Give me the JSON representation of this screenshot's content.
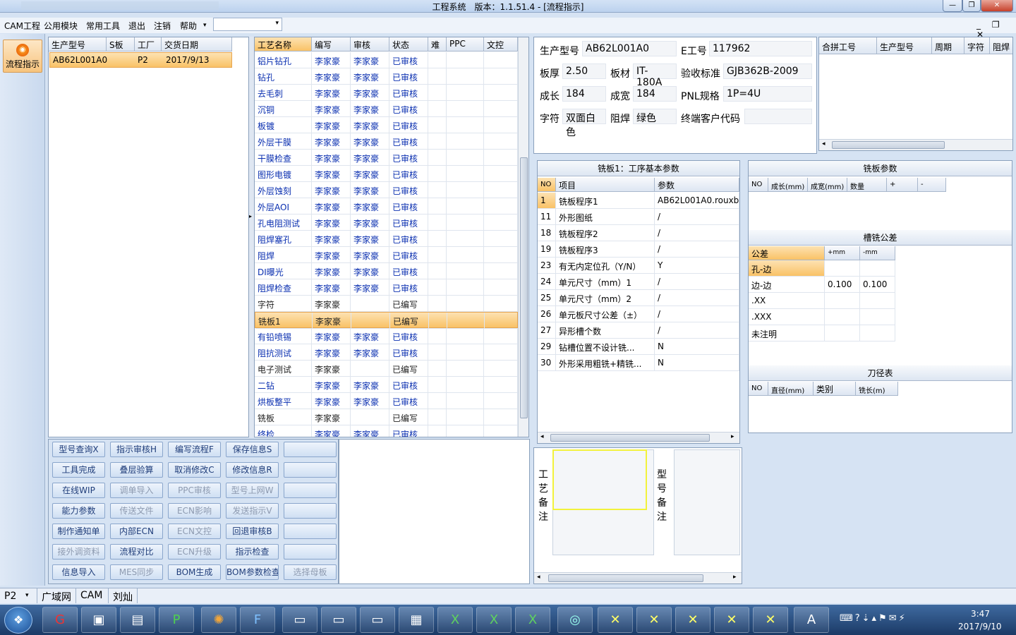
{
  "window": {
    "title": "工程系统　版本：1.1.51.4 - [流程指示]",
    "min": "—",
    "max": "❐",
    "close": "✕"
  },
  "menu": [
    {
      "label": "CAM工程"
    },
    {
      "label": "公用模块"
    },
    {
      "label": "常用工具"
    },
    {
      "label": "退出"
    },
    {
      "label": "注销"
    },
    {
      "label": "帮助"
    }
  ],
  "menu_arrow": "▾",
  "mdi_controls": "_ ❐ ✕",
  "nav": {
    "label": "流程指示"
  },
  "order_table": {
    "headers": [
      "生产型号",
      "S板",
      "工厂",
      "交货日期"
    ],
    "rows": [
      [
        "AB62L001A0",
        "",
        "P2",
        "2017/9/13"
      ]
    ]
  },
  "process_table": {
    "headers": [
      "工艺名称",
      "编写",
      "审核",
      "状态",
      "难",
      "PPC",
      "文控"
    ],
    "rows": [
      [
        "铝片钻孔",
        "李家豪",
        "李家豪",
        "已审核"
      ],
      [
        "钻孔",
        "李家豪",
        "李家豪",
        "已审核"
      ],
      [
        "去毛刺",
        "李家豪",
        "李家豪",
        "已审核"
      ],
      [
        "沉铜",
        "李家豪",
        "李家豪",
        "已审核"
      ],
      [
        "板镀",
        "李家豪",
        "李家豪",
        "已审核"
      ],
      [
        "外层干膜",
        "李家豪",
        "李家豪",
        "已审核"
      ],
      [
        "干膜检查",
        "李家豪",
        "李家豪",
        "已审核"
      ],
      [
        "图形电镀",
        "李家豪",
        "李家豪",
        "已审核"
      ],
      [
        "外层蚀刻",
        "李家豪",
        "李家豪",
        "已审核"
      ],
      [
        "外层AOI",
        "李家豪",
        "李家豪",
        "已审核"
      ],
      [
        "孔电阻测试",
        "李家豪",
        "李家豪",
        "已审核"
      ],
      [
        "阻焊塞孔",
        "李家豪",
        "李家豪",
        "已审核"
      ],
      [
        "阻焊",
        "李家豪",
        "李家豪",
        "已审核"
      ],
      [
        "DI曝光",
        "李家豪",
        "李家豪",
        "已审核"
      ],
      [
        "阻焊检查",
        "李家豪",
        "李家豪",
        "已审核"
      ],
      [
        "字符",
        "李家豪",
        "",
        "已编写"
      ],
      [
        "铣板1",
        "李家豪",
        "",
        "已编写"
      ],
      [
        "有铅喷锡",
        "李家豪",
        "李家豪",
        "已审核"
      ],
      [
        "阻抗测试",
        "李家豪",
        "李家豪",
        "已审核"
      ],
      [
        "电子测试",
        "李家豪",
        "",
        "已编写"
      ],
      [
        "二钻",
        "李家豪",
        "李家豪",
        "已审核"
      ],
      [
        "烘板整平",
        "李家豪",
        "李家豪",
        "已审核"
      ],
      [
        "铣板",
        "李家豪",
        "",
        "已编写"
      ],
      [
        "终检",
        "李家豪",
        "李家豪",
        "已审核"
      ]
    ]
  },
  "buttons": [
    [
      "型号查询X",
      "指示审核H",
      "编写流程F",
      "保存信息S",
      ""
    ],
    [
      "工具完成",
      "叠层验算",
      "取消修改C",
      "修改信息R",
      ""
    ],
    [
      "在线WIP",
      "调单导入",
      "PPC审核",
      "型号上网W",
      ""
    ],
    [
      "能力参数",
      "传送文件",
      "ECN影响",
      "发送指示V",
      ""
    ],
    [
      "制作通知单",
      "内部ECN",
      "ECN文控",
      "回退审核B",
      ""
    ],
    [
      "接外调资料",
      "流程对比",
      "ECN升级",
      "指示检查",
      ""
    ],
    [
      "信息导入",
      "MES同步",
      "BOM生成",
      "BOM参数检查",
      "选择母板"
    ]
  ],
  "info": {
    "model_label": "生产型号",
    "model": "AB62L001A0",
    "eno_label": "E工号",
    "eno": "117962",
    "thick_label": "板厚",
    "thick": "2.50",
    "mat_label": "板材",
    "mat": "IT-180A",
    "std_label": "验收标准",
    "std": "GJB362B-2009",
    "len_label": "成长",
    "len": "184",
    "wid_label": "成宽",
    "wid": "184",
    "pnl_label": "PNL规格",
    "pnl": "1P=4U",
    "char_label": "字符",
    "char": "双面白色",
    "mask_label": "阻焊",
    "mask": "绿色",
    "cust_label": "终端客户代码",
    "cust": ""
  },
  "merge_table": {
    "headers": [
      "合拼工号",
      "生产型号",
      "周期",
      "字符",
      "阻焊"
    ]
  },
  "params": {
    "title": "铣板1：工序基本参数",
    "headers": [
      "NO",
      "项目",
      "参数"
    ],
    "rows": [
      [
        "1",
        "铣板程序1",
        "AB62L001A0.rouxb"
      ],
      [
        "11",
        "外形图纸",
        "/"
      ],
      [
        "18",
        "铣板程序2",
        "/"
      ],
      [
        "19",
        "铣板程序3",
        "/"
      ],
      [
        "23",
        "有无内定位孔（Y/N）",
        "Y"
      ],
      [
        "24",
        "单元尺寸（mm）1",
        "/"
      ],
      [
        "25",
        "单元尺寸（mm）2",
        "/"
      ],
      [
        "26",
        "单元板尺寸公差（±）",
        "/"
      ],
      [
        "27",
        "异形槽个数",
        "/"
      ],
      [
        "29",
        "钻槽位置不设计铣...",
        "N"
      ],
      [
        "30",
        "外形采用粗铣+精铣...",
        "N"
      ]
    ]
  },
  "mill_params": {
    "title": "铣板参数",
    "headers": [
      "NO",
      "成长(mm)",
      "成宽(mm)",
      "数量",
      "+",
      "-"
    ]
  },
  "tolerance": {
    "title": "槽铣公差",
    "headers": [
      "公差",
      "+mm",
      "-mm"
    ],
    "rows": [
      [
        "孔-边",
        "",
        ""
      ],
      [
        "边-边",
        "0.100",
        "0.100"
      ],
      [
        ".XX",
        "",
        ""
      ],
      [
        ".XXX",
        "",
        ""
      ],
      [
        "未注明",
        "",
        ""
      ]
    ]
  },
  "tools": {
    "title": "刀径表",
    "headers": [
      "NO",
      "直径(mm)",
      "类别",
      "铣长(m)"
    ]
  },
  "notes": {
    "process_note": "工艺备注",
    "model_note": "型号备注"
  },
  "status": {
    "plant": "P2",
    "items": [
      "广域网",
      "CAM",
      "刘灿"
    ]
  },
  "taskbar": {
    "time": "3:47",
    "date": "2017/9/10"
  }
}
